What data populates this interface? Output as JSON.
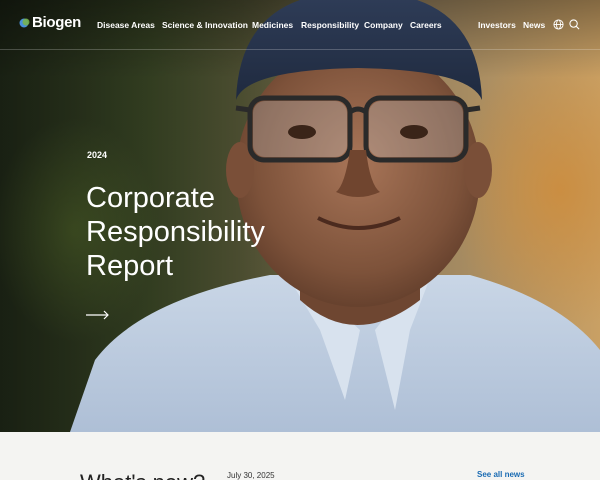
{
  "brand": {
    "name": "Biogen"
  },
  "nav": {
    "items": [
      {
        "label": "Disease Areas"
      },
      {
        "label": "Science & Innovation"
      },
      {
        "label": "Medicines"
      },
      {
        "label": "Responsibility"
      },
      {
        "label": "Company"
      },
      {
        "label": "Careers"
      }
    ],
    "utility": [
      {
        "label": "Investors"
      },
      {
        "label": "News"
      }
    ],
    "icons": [
      "globe-icon",
      "search-icon"
    ]
  },
  "hero": {
    "eyebrow": "2024",
    "title": "Corporate Responsibility Report",
    "cta_icon": "arrow-right-icon"
  },
  "news": {
    "heading": "What's new?",
    "date": "July 30, 2025",
    "see_all": "See all news"
  },
  "colors": {
    "link": "#1a6bb3",
    "logo_blue": "#4a90d9",
    "logo_green": "#7ab648"
  }
}
